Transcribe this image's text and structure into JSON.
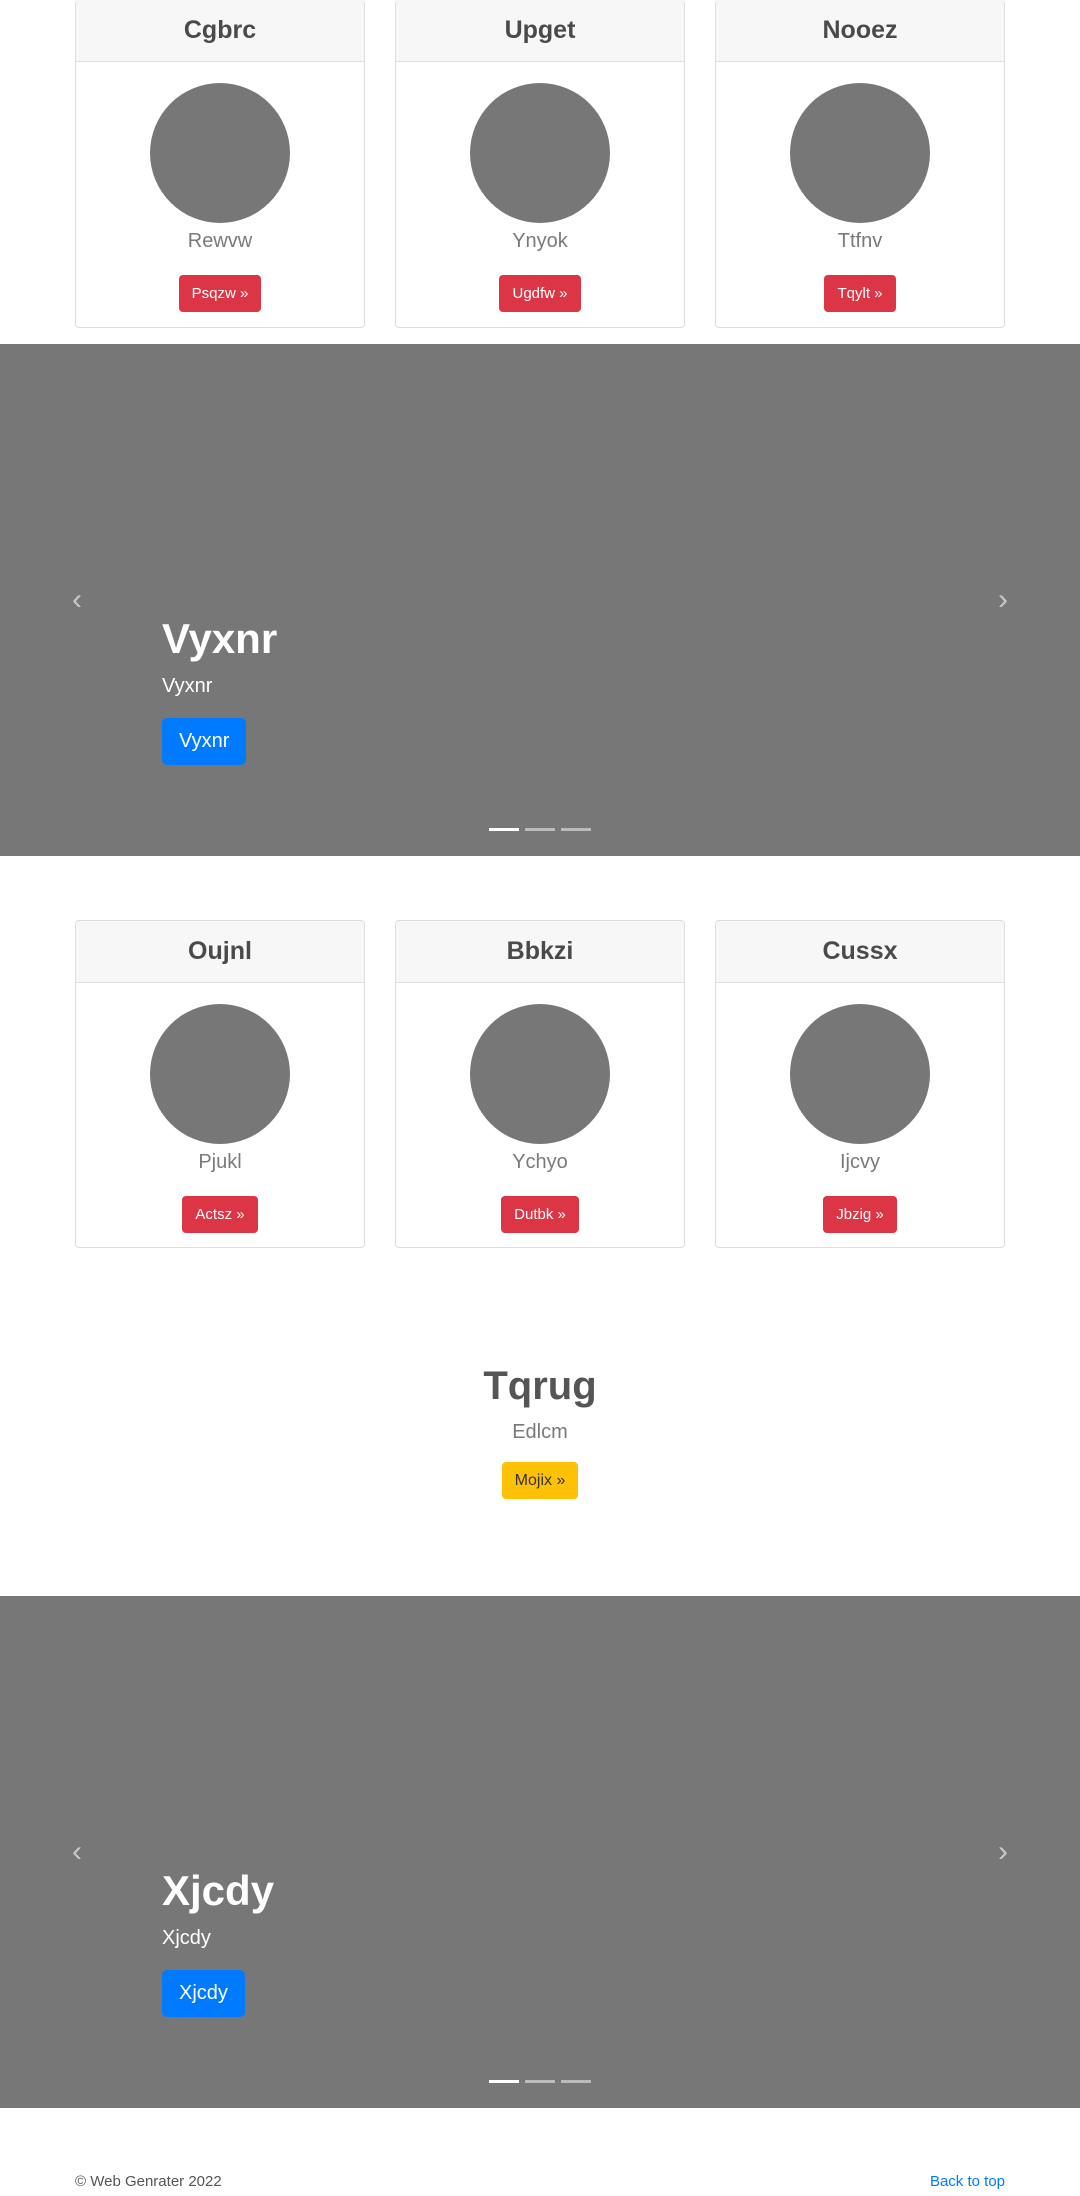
{
  "cards_row_1": [
    {
      "title": "Cgbrc",
      "text": "Rewvw",
      "button": "Psqzw »"
    },
    {
      "title": "Upget",
      "text": "Ynyok",
      "button": "Ugdfw »"
    },
    {
      "title": "Nooez",
      "text": "Ttfnv",
      "button": "Tqylt »"
    }
  ],
  "carousel_1": {
    "title": "Vyxnr",
    "text": "Vyxnr",
    "button": "Vyxnr",
    "prev_icon": "‹",
    "next_icon": "›",
    "active_slide": 1,
    "slide_count": 3
  },
  "cards_row_2": [
    {
      "title": "Oujnl",
      "text": "Pjukl",
      "button": "Actsz »"
    },
    {
      "title": "Bbkzi",
      "text": "Ychyo",
      "button": "Dutbk »"
    },
    {
      "title": "Cussx",
      "text": "Ijcvy",
      "button": "Jbzig »"
    }
  ],
  "hero": {
    "title": "Tqrug",
    "text": "Edlcm",
    "button": "Mojix »"
  },
  "carousel_2": {
    "title": "Xjcdy",
    "text": "Xjcdy",
    "button": "Xjcdy",
    "prev_icon": "‹",
    "next_icon": "›",
    "active_slide": 1,
    "slide_count": 3
  },
  "footer": {
    "copyright": "© Web Genrater 2022",
    "back_to_top": "Back to top"
  },
  "colors": {
    "placeholder_gray": "#777777",
    "danger": "#dc3545",
    "primary": "#007bff",
    "warning": "#ffc107"
  }
}
